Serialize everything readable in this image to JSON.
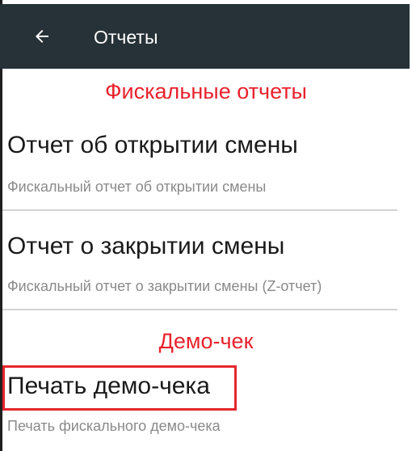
{
  "appbar": {
    "title": "Отчеты",
    "back_icon": "arrow-left-icon"
  },
  "sections": [
    {
      "header": "Фискальные отчеты",
      "items": [
        {
          "title": "Отчет об открытии смены",
          "summary": "Фискальный отчет об открытии смены"
        },
        {
          "title": "Отчет о закрытии смены",
          "summary": "Фискальный отчет о закрытии смены (Z-отчет)"
        }
      ]
    },
    {
      "header": "Демо-чек",
      "items": [
        {
          "title": "Печать демо-чека",
          "summary": "Печать фискального демо-чека"
        }
      ]
    }
  ],
  "colors": {
    "appbar_bg": "#263238",
    "accent_red": "#e8222d",
    "summary_grey": "#8a8a8a"
  }
}
